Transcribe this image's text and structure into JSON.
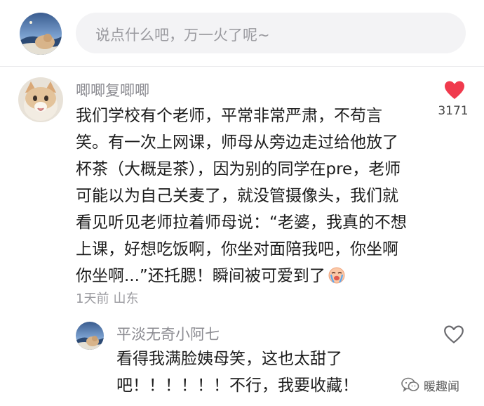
{
  "comment_input": {
    "placeholder": "说点什么吧，万一火了呢~"
  },
  "main_comment": {
    "username": "唧唧复唧唧",
    "lines": [
      "我们学校有个老师，平常非常严肃，不苟言",
      "笑。有一次上网课，师母从旁边走过给他放了",
      "杯茶（大概是茶），因为别的同学在pre，老师",
      "可能以为自己关麦了，就没管摄像头，我们就",
      "看见听见老师拉着师母说：“老婆，我真的不想",
      "上课，好想吃饭啊，你坐对面陪我吧，你坐啊",
      "你坐啊...”还托腮！瞬间被可爱到了"
    ],
    "emoji": "crying-face-emoji",
    "time": "1天前",
    "location": "山东",
    "likes": "3171",
    "liked": true,
    "like_color": "#f03a4d"
  },
  "reply": {
    "username": "平淡无奇小阿七",
    "lines": [
      "看得我满脸姨母笑，这也太甜了",
      "吧！！！！！！不行，我要收藏！"
    ],
    "liked": false
  },
  "watermark": {
    "text": "暖趣闻",
    "icon": "wechat-icon"
  }
}
